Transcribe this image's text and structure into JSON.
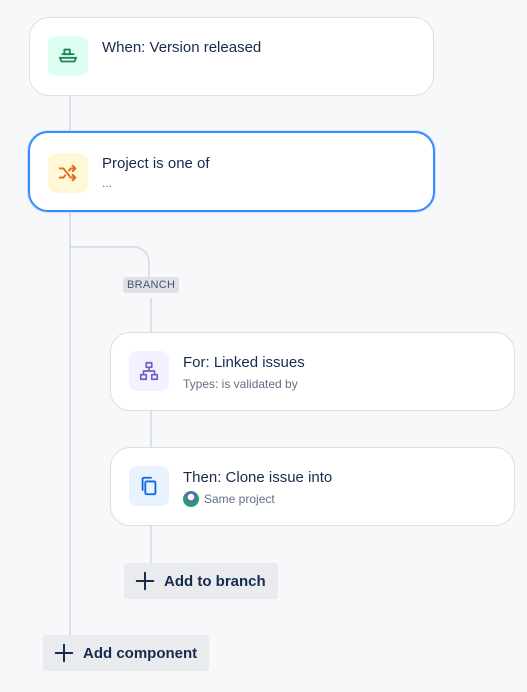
{
  "trigger": {
    "title": "When: Version released",
    "icon": "ship-icon",
    "tile_color": "#dcfff1",
    "icon_color": "#1f845a"
  },
  "condition": {
    "title": "Project is one of",
    "subtitle": "...",
    "icon": "shuffle-icon",
    "tile_color": "#fff7d6",
    "icon_color": "#e56910",
    "selected_border": "#388bff"
  },
  "branch": {
    "label": "BRANCH",
    "for_card": {
      "title": "For: Linked issues",
      "subtitle": "Types: is validated by",
      "icon": "hierarchy-icon",
      "tile_color": "#f3f0ff",
      "icon_color": "#6e5dc6"
    },
    "then_card": {
      "title": "Then: Clone issue into",
      "subtitle": "Same project",
      "icon": "copy-icon",
      "tile_color": "#e9f2ff",
      "icon_color": "#0c66e4"
    },
    "add_to_branch_label": "Add to branch"
  },
  "add_component_label": "Add component"
}
